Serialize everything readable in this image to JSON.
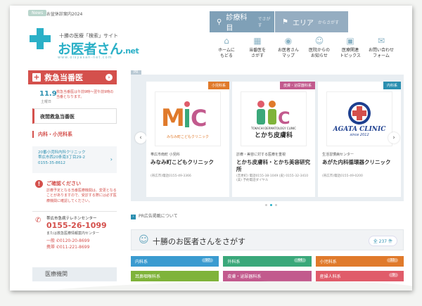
{
  "header": {
    "tag": "News",
    "tag_text": "お盆休診案内2024",
    "tagline": "十勝の医療「検索」サイト",
    "logo_main": "お医者さん",
    "logo_net": ".net",
    "logo_url": "www.oisyasan-net.com",
    "search_specialty": "診療科目",
    "search_specialty_sub": "でさがす",
    "search_area": "エリア",
    "search_area_sub": "からさがす",
    "nav": [
      {
        "icon": "home-icon",
        "glyph": "⌂",
        "label": "ホームに\nもどる"
      },
      {
        "icon": "hospital-icon",
        "glyph": "▦",
        "label": "当番医を\nさがす"
      },
      {
        "icon": "map-pin-icon",
        "glyph": "◉",
        "label": "お医者さん\nマップ"
      },
      {
        "icon": "doctor-icon",
        "glyph": "☺",
        "label": "医院からの\nお知らせ"
      },
      {
        "icon": "medical-bag-icon",
        "glyph": "▣",
        "label": "医療関連\nトピックス"
      },
      {
        "icon": "mail-icon",
        "glyph": "✉",
        "label": "お問い合わせ\nフォーム"
      }
    ]
  },
  "sidebar": {
    "emergency_title": "救急当番医",
    "date": "11.9",
    "day": "土曜日",
    "date_note": "救急当番医は午前9時～翌午前9時の当番となります。",
    "night_title": "夜間救急当番医",
    "category": "内科・小児科系",
    "clinic_info": "20番小児科内科クリニック\n帯広市西20条南3丁目29-2\n0155-35-8612",
    "warning_title": "ご確認ください",
    "warning_body": "診療予定となる当番医療機関は、変更となることがありますので、受診する際には必ず医療機関に確認してください。",
    "tel_label": "帯広市急病テレホンセンター",
    "tel_number": "0155-26-1099",
    "tel_sub": "または救急医療情報案内センター",
    "tel_line1": "一般 ✆0120-20-8699",
    "tel_line2": "携帯 ✆011-221-8699",
    "footer": "医療機関"
  },
  "carousel": {
    "pr_label": "PR",
    "cards": [
      {
        "badge": "小児科系",
        "badge_color": "#e07a2b",
        "logo": "MiC",
        "logo_sub": "みなみ町こどもクリニック",
        "category": "帯広市南町 小児科",
        "name": "みなみ町こどもクリニック",
        "address": "(帯広市)電話0155-49-3366"
      },
      {
        "badge": "皮膚・泌尿器科系",
        "badge_color": "#c25a8d",
        "logo": "TiC",
        "logo_sub": "TOKACHI DERMATOLOGY CLINIC",
        "logo_sub2": "とかち皮膚科",
        "category": "診療・美容に対する医療を重視",
        "name": "とかち皮膚科・とかち美容研究所",
        "address": "(音更町) 電話0155-38-1049 (皮) 0155-32-3410 (美) 予約電話ダイヤル"
      },
      {
        "badge": "内科系",
        "badge_color": "#2b8fb0",
        "logo": "AGATA CLINIC",
        "logo_sub": "since 2012",
        "category": "生活習慣病センター",
        "name": "あがた内科循環器クリニック",
        "address": "(帯広市)電話0155-49-0200"
      }
    ],
    "notice": "PR広告掲載について"
  },
  "search_section": {
    "title": "十勝のお医者さんをさがす",
    "count": "全 237 件",
    "items": [
      {
        "label": "内科系",
        "count": "97",
        "color": "#3a9bd0"
      },
      {
        "label": "外科系",
        "count": "44",
        "color": "#3aa87a"
      },
      {
        "label": "小児科系",
        "count": "33",
        "color": "#e07a2b"
      },
      {
        "label": "耳鼻咽喉科系",
        "count": "",
        "color": "#7fb33a"
      },
      {
        "label": "皮膚・泌尿器科系",
        "count": "",
        "color": "#c25a8d"
      },
      {
        "label": "産婦人科系",
        "count": "9",
        "color": "#e05c6a"
      }
    ]
  }
}
